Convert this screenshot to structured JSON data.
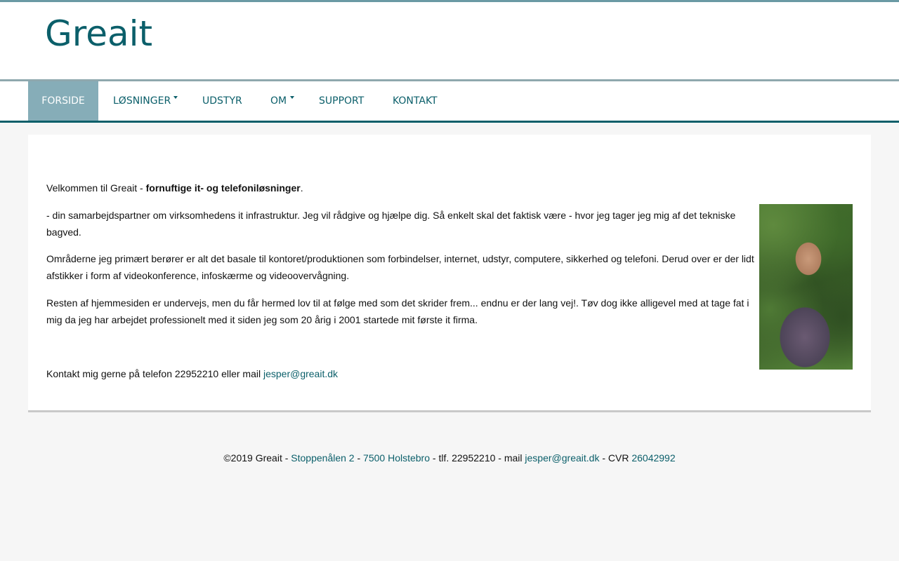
{
  "site": {
    "logo_text": "Greait",
    "colors": {
      "brand": "#0b5f6a",
      "nav_active_bg": "#86adb8",
      "link": "#0b5f6a"
    }
  },
  "nav": {
    "items": [
      {
        "label": "FORSIDE",
        "active": true,
        "has_dropdown": false
      },
      {
        "label": "LØSNINGER",
        "active": false,
        "has_dropdown": true
      },
      {
        "label": "UDSTYR",
        "active": false,
        "has_dropdown": false
      },
      {
        "label": "OM",
        "active": false,
        "has_dropdown": true
      },
      {
        "label": "SUPPORT",
        "active": false,
        "has_dropdown": false
      },
      {
        "label": "KONTAKT",
        "active": false,
        "has_dropdown": false
      }
    ]
  },
  "main": {
    "intro_prefix": "Velkommen til Greait - ",
    "intro_bold": "fornuftige it- og telefoniløsninger",
    "intro_suffix": ".",
    "paragraph1": "- din samarbejdspartner om virksomhedens it infrastruktur. Jeg vil rådgive og hjælpe dig. Så enkelt skal det faktisk være - hvor jeg tager jeg mig af det tekniske bagved.",
    "paragraph2": "Områderne jeg primært berører er alt det basale til kontoret/produktionen som forbindelser, internet, udstyr, computere, sikkerhed og telefoni. Derud over er der lidt afstikker i form af videokonference, infoskærme og videoovervågning.",
    "paragraph3": "Resten af hjemmesiden er undervejs, men du får hermed lov til at følge med som det skrider frem... endnu er der lang vej!. Tøv dog ikke alligevel med at tage fat i mig da jeg har arbejdet professionelt med it siden jeg som 20 årig i 2001 startede mit første it firma.",
    "contact_prefix": "Kontakt mig gerne på telefon 22952210 eller mail ",
    "contact_email": "jesper@greait.dk"
  },
  "footer": {
    "copyright": "©2019 Greait - ",
    "street": "Stoppenålen 2",
    "sep1": " - ",
    "city": "7500 Holstebro",
    "phone_text": " - tlf. 22952210 - mail ",
    "email": "jesper@greait.dk",
    "cvr_label": " - CVR ",
    "cvr": "26042992"
  }
}
